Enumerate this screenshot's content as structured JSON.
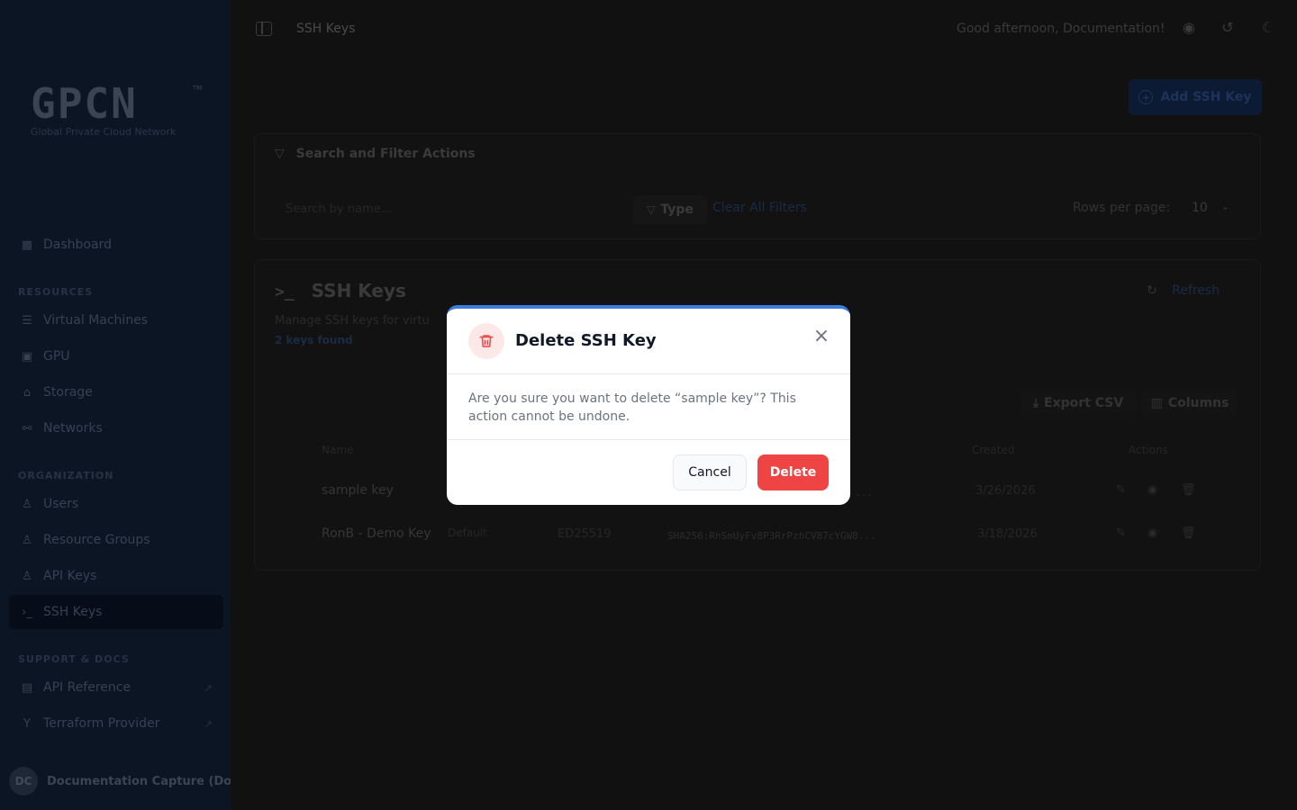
{
  "sidebar": {
    "logo": "GPCN",
    "logo_tm": "TM",
    "logo_subtitle": "Global Private Cloud Network",
    "dashboard": "Dashboard",
    "section_resources": "RESOURCES",
    "virtual_machines": "Virtual Machines",
    "gpu": "GPU",
    "storage": "Storage",
    "networks": "Networks",
    "section_organization": "ORGANIZATION",
    "users": "Users",
    "resource_groups": "Resource Groups",
    "api_keys": "API Keys",
    "ssh_keys": "SSH Keys",
    "section_support": "SUPPORT & DOCS",
    "api_reference": "API Reference",
    "terraform_provider": "Terraform Provider",
    "user_initials": "DC",
    "user_name": "Documentation Capture (Do"
  },
  "topbar": {
    "breadcrumb": "SSH Keys",
    "greeting": "Good afternoon, Documentation!"
  },
  "page": {
    "add_button": "Add SSH Key"
  },
  "filters": {
    "title": "Search and Filter Actions",
    "search_placeholder": "Search by name...",
    "type_label": "Type",
    "clear_all": "Clear All Filters",
    "rows_per_page_label": "Rows per page:",
    "rows_per_page_value": "10"
  },
  "table": {
    "title": "SSH Keys",
    "description": "Manage SSH keys for virtu",
    "count": "2 keys found",
    "refresh": "Refresh",
    "export_csv": "Export CSV",
    "columns": "Columns",
    "headers": {
      "name": "Name",
      "created": "Created",
      "actions": "Actions"
    },
    "rows": [
      {
        "name": "sample key",
        "badge": "",
        "type": "",
        "fingerprint": "...",
        "created": "3/26/2026"
      },
      {
        "name": "RonB - Demo Key",
        "badge": "Default",
        "type": "ED25519",
        "fingerprint": "SHA256:RhSmUyFv8P3RrPzhCV87cYGW8...",
        "created": "3/18/2026"
      }
    ]
  },
  "modal": {
    "title": "Delete SSH Key",
    "message": "Are you sure you want to delete “sample key”? This action cannot be undone.",
    "cancel": "Cancel",
    "delete": "Delete",
    "accent_color": "#3b7ddd",
    "danger_color": "#ef4444"
  }
}
